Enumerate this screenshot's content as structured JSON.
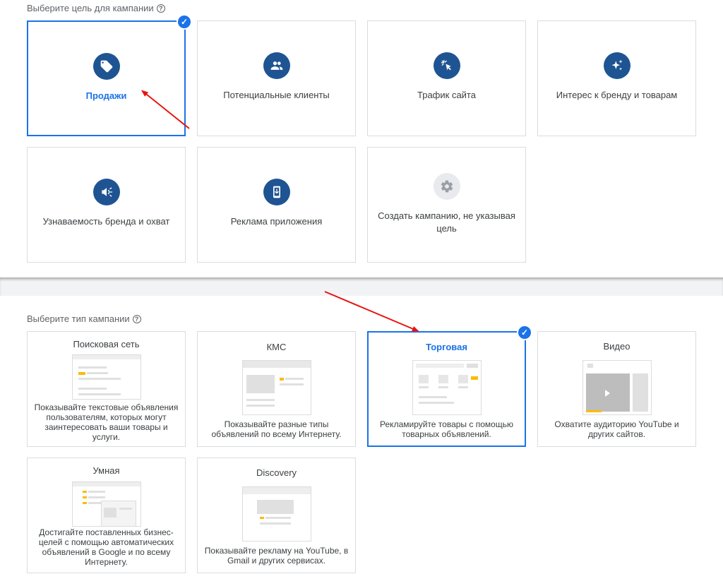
{
  "goal_section": {
    "title": "Выберите цель для кампании",
    "help_icon": "?",
    "cards": [
      {
        "label": "Продажи",
        "icon": "tag-icon",
        "selected": true
      },
      {
        "label": "Потенциальные клиенты",
        "icon": "people-icon",
        "selected": false
      },
      {
        "label": "Трафик сайта",
        "icon": "cursor-click-icon",
        "selected": false
      },
      {
        "label": "Интерес к бренду и товарам",
        "icon": "sparkle-icon",
        "selected": false
      },
      {
        "label": "Узнаваемость бренда и охват",
        "icon": "megaphone-icon",
        "selected": false
      },
      {
        "label": "Реклама приложения",
        "icon": "phone-download-icon",
        "selected": false
      },
      {
        "label": "Создать кампанию, не указывая цель",
        "icon": "gear-icon",
        "selected": false
      }
    ]
  },
  "type_section": {
    "title": "Выберите тип кампании",
    "help_icon": "?",
    "cards": [
      {
        "title": "Поисковая сеть",
        "desc": "Показывайте текстовые объявления пользователям, которых могут заинтересовать ваши товары и услуги.",
        "selected": false
      },
      {
        "title": "КМС",
        "desc": "Показывайте разные типы объявлений по всему Интернету.",
        "selected": false
      },
      {
        "title": "Торговая",
        "desc": "Рекламируйте товары с помощью товарных объявлений.",
        "selected": true
      },
      {
        "title": "Видео",
        "desc": "Охватите аудиторию YouTube и других сайтов.",
        "selected": false
      },
      {
        "title": "Умная",
        "desc": "Достигайте поставленных бизнес-целей с помощью автоматических объявлений в Google и по всему Интернету.",
        "selected": false
      },
      {
        "title": "Discovery",
        "desc": "Показывайте рекламу на YouTube, в Gmail и других сервисах.",
        "selected": false
      }
    ]
  },
  "colors": {
    "accent": "#1a73e8",
    "icon_bg": "#1f5493",
    "arrow": "#e8140f",
    "thumb_highlight": "#fbbc04"
  },
  "check_mark": "✓"
}
